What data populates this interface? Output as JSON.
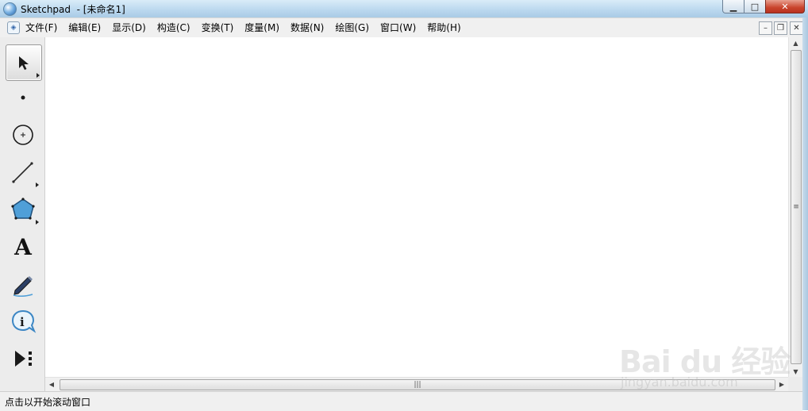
{
  "window": {
    "title": "Sketchpad  - [未命名1]",
    "minimize_icon": "minimize-icon",
    "maximize_icon": "maximize-icon",
    "close_icon": "close-icon"
  },
  "menu": {
    "items": [
      {
        "label": "文件(F)"
      },
      {
        "label": "编辑(E)"
      },
      {
        "label": "显示(D)"
      },
      {
        "label": "构造(C)"
      },
      {
        "label": "变换(T)"
      },
      {
        "label": "度量(M)"
      },
      {
        "label": "数据(N)"
      },
      {
        "label": "绘图(G)"
      },
      {
        "label": "窗口(W)"
      },
      {
        "label": "帮助(H)"
      }
    ]
  },
  "toolbox": {
    "tools": [
      {
        "name": "arrow-select-tool",
        "icon": "arrow-icon",
        "active": true,
        "has_submenu": true
      },
      {
        "name": "point-tool",
        "icon": "point-icon",
        "active": false,
        "has_submenu": false
      },
      {
        "name": "compass-tool",
        "icon": "circle-icon",
        "active": false,
        "has_submenu": false
      },
      {
        "name": "straightedge-tool",
        "icon": "segment-icon",
        "active": false,
        "has_submenu": true
      },
      {
        "name": "polygon-tool",
        "icon": "pentagon-icon",
        "active": false,
        "has_submenu": true
      },
      {
        "name": "text-tool",
        "icon": "text-a-icon",
        "active": false,
        "has_submenu": false
      },
      {
        "name": "marker-tool",
        "icon": "marker-pen-icon",
        "active": false,
        "has_submenu": false
      },
      {
        "name": "information-tool",
        "icon": "info-icon",
        "active": false,
        "has_submenu": false
      },
      {
        "name": "custom-tool",
        "icon": "custom-tool-icon",
        "active": false,
        "has_submenu": false
      }
    ],
    "text_tool_glyph": "A",
    "accent": "#4f9fd8"
  },
  "status": {
    "text": "点击以开始滚动窗口"
  },
  "watermark": {
    "logo": "Bai du 经验",
    "url": "jingyan.baidu.com"
  }
}
